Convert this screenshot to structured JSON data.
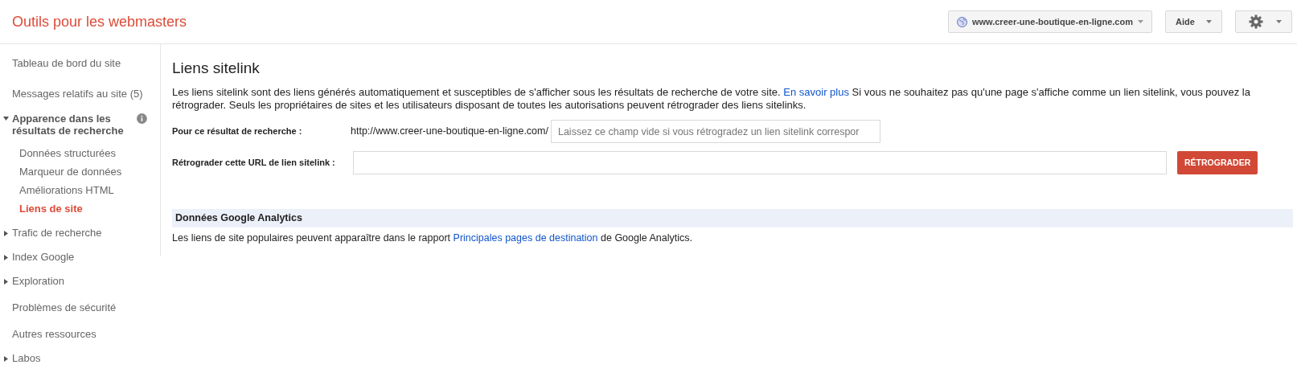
{
  "header": {
    "title": "Outils pour les webmasters",
    "site_selector": "www.creer-une-boutique-en-ligne.com",
    "help_button": "Aide"
  },
  "sidebar": {
    "items": [
      {
        "label": "Tableau de bord du site",
        "kind": "plain"
      },
      {
        "label": "Messages relatifs au site (5)",
        "kind": "plain"
      },
      {
        "label": "Apparence dans les résultats de recherche",
        "kind": "section",
        "expanded": true,
        "info": true,
        "children": [
          {
            "label": "Données structurées",
            "selected": false
          },
          {
            "label": "Marqueur de données",
            "selected": false
          },
          {
            "label": "Améliorations HTML",
            "selected": false
          },
          {
            "label": "Liens de site",
            "selected": true
          }
        ]
      },
      {
        "label": "Trafic de recherche",
        "kind": "section",
        "expanded": false
      },
      {
        "label": "Index Google",
        "kind": "section",
        "expanded": false
      },
      {
        "label": "Exploration",
        "kind": "section",
        "expanded": false
      },
      {
        "label": "Problèmes de sécurité",
        "kind": "plain"
      },
      {
        "label": "Autres ressources",
        "kind": "plain"
      },
      {
        "label": "Labos",
        "kind": "section",
        "expanded": false
      }
    ]
  },
  "main": {
    "title": "Liens sitelink",
    "intro_before": "Les liens sitelink sont des liens générés automatiquement et susceptibles de s'afficher sous les résultats de recherche de votre site.",
    "intro_link": "En savoir plus",
    "intro_after": "Si vous ne souhaitez pas qu'une page s'affiche comme un lien sitelink, vous pouvez la rétrograder. Seuls les propriétaires de sites et les utilisateurs disposant de toutes les autorisations peuvent rétrograder des liens sitelinks.",
    "search_result_label": "Pour ce résultat de recherche :",
    "search_result_prefix": "http://www.creer-une-boutique-en-ligne.com/",
    "search_result_placeholder": "Laissez ce champ vide si vous rétrogradez un lien sitelink correspor",
    "demote_label": "Rétrograder cette URL de lien sitelink :",
    "demote_button": "RÉTROGRADER",
    "analytics_heading": "Données Google Analytics",
    "analytics_before": "Les liens de site populaires peuvent apparaître dans le rapport",
    "analytics_link": "Principales pages de destination",
    "analytics_after": "de Google Analytics."
  }
}
